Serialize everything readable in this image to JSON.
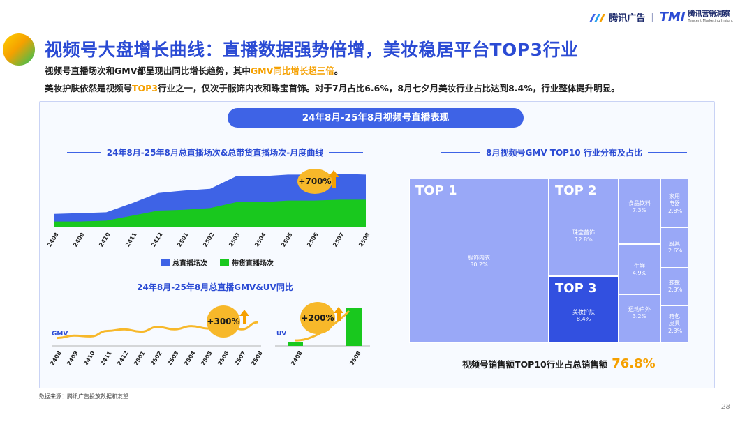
{
  "header": {
    "title": "视频号大盘增长曲线：直播数据强势倍增，美妆稳居平台TOP3行业",
    "subtitle1_pre": "视频号直播场次和GMV都呈现出同比增长趋势，其中",
    "subtitle1_hl": "GMV同比增长超三倍",
    "subtitle1_post": "。",
    "subtitle2_pre": "美妆护肤依然是视频号",
    "subtitle2_hl": "TOP3",
    "subtitle2_post": "行业之一，仅次于服饰内衣和珠宝首饰。对于7月占比6.6%，8月七夕月美妆行业占比达到8.4%，行业整体提升明显。",
    "logo_brand": "腾讯广告",
    "logo_sep": "|",
    "logo_tmi": "TMI",
    "logo_tmi_cn": "腾讯营销洞察",
    "logo_tmi_en": "Tencent Marketing Insight"
  },
  "banner": "24年8月-25年8月视频号直播表现",
  "footer": {
    "source": "数据来源：腾讯广告投放数据和友望",
    "page": "28"
  },
  "colors": {
    "blue": "#3e63e6",
    "green": "#19c81e",
    "gold": "#f5a000",
    "treemap_light": "#99a8f7",
    "treemap_dark": "#3250e0"
  },
  "chart_data": [
    {
      "type": "area",
      "title": "24年8月-25年8月总直播场次&总带货直播场次-月度曲线",
      "categories": [
        "2408",
        "2409",
        "2410",
        "2411",
        "2412",
        "2501",
        "2502",
        "2503",
        "2504",
        "2505",
        "2506",
        "2507",
        "2508"
      ],
      "series": [
        {
          "name": "总直播场次",
          "values": [
            16,
            17,
            18,
            29,
            41,
            44,
            46,
            61,
            61,
            63,
            63,
            64,
            63
          ]
        },
        {
          "name": "带货直播场次",
          "values": [
            7,
            7,
            8,
            14,
            20,
            21,
            23,
            30,
            30,
            32,
            32,
            33,
            33
          ]
        }
      ],
      "ylim": [
        0,
        80
      ],
      "annotation": "+700%",
      "legend": "bottom"
    },
    {
      "type": "line",
      "title": "24年8月-25年8月总直播GMV&UV同比",
      "ylabel": "GMV",
      "categories": [
        "2408",
        "2409",
        "2410",
        "2411",
        "2412",
        "2501",
        "2502",
        "2503",
        "2504",
        "2505",
        "2506",
        "2507",
        "2508"
      ],
      "series": [
        {
          "values": [
            10,
            13,
            12,
            19,
            21,
            18,
            24,
            21,
            25,
            22,
            29,
            21,
            30
          ]
        }
      ],
      "ylim": [
        0,
        60
      ],
      "annotation": "+300%"
    },
    {
      "type": "bar",
      "ylabel": "UV",
      "categories": [
        "2408",
        "2508"
      ],
      "values": [
        1,
        9
      ],
      "ylim": [
        0,
        10
      ],
      "annotation": "+200%"
    },
    {
      "type": "treemap",
      "title": "8月视频号GMV TOP10 行业分布及占比",
      "items": [
        {
          "label": "服饰内衣",
          "value": "30.2%",
          "rank": "TOP 1"
        },
        {
          "label": "珠宝首饰",
          "value": "12.8%",
          "rank": "TOP 2"
        },
        {
          "label": "美妆护肤",
          "value": "8.4%",
          "rank": "TOP 3"
        },
        {
          "label": "食品饮料",
          "value": "7.3%"
        },
        {
          "label": "生鲜",
          "value": "4.9%"
        },
        {
          "label": "运动户外",
          "value": "3.2%"
        },
        {
          "label": "家用电器",
          "value": "2.8%"
        },
        {
          "label": "厨具",
          "value": "2.6%"
        },
        {
          "label": "鞋靴",
          "value": "2.3%"
        },
        {
          "label": "箱包皮具",
          "value": "2.3%"
        }
      ],
      "total_label": "视频号销售额TOP10行业占总销售额",
      "total_value": "76.8%"
    }
  ]
}
